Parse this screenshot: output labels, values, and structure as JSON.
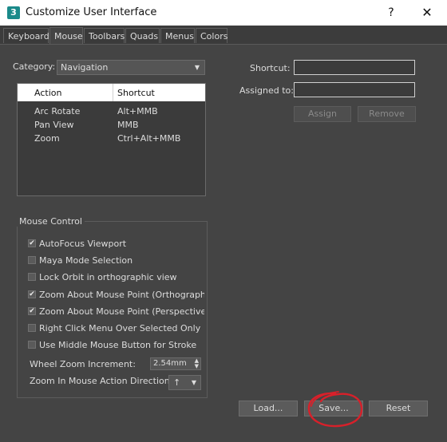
{
  "window": {
    "app_icon": "3",
    "title": "Customize User Interface",
    "help": "?",
    "close": "✕"
  },
  "tabs": [
    {
      "label": "Keyboard"
    },
    {
      "label": "Mouse",
      "active": true
    },
    {
      "label": "Toolbars"
    },
    {
      "label": "Quads"
    },
    {
      "label": "Menus"
    },
    {
      "label": "Colors"
    }
  ],
  "category": {
    "label": "Category:",
    "value": "Navigation"
  },
  "actions_table": {
    "columns": [
      "Action",
      "Shortcut"
    ],
    "rows": [
      {
        "action": "Arc Rotate",
        "shortcut": "Alt+MMB"
      },
      {
        "action": "Pan View",
        "shortcut": "MMB"
      },
      {
        "action": "Zoom",
        "shortcut": "Ctrl+Alt+MMB"
      }
    ]
  },
  "shortcut_panel": {
    "shortcut_label": "Shortcut:",
    "shortcut_value": "",
    "assigned_label": "Assigned to:",
    "assigned_value": "",
    "assign_button": "Assign",
    "remove_button": "Remove"
  },
  "mouse_control": {
    "title": "Mouse Control",
    "options": [
      {
        "label": "AutoFocus Viewport",
        "checked": true
      },
      {
        "label": "Maya Mode Selection",
        "checked": false
      },
      {
        "label": "Lock Orbit in orthographic view",
        "checked": false
      },
      {
        "label": "Zoom About Mouse Point (Orthographic)",
        "checked": true
      },
      {
        "label": "Zoom About Mouse Point (Perspective)",
        "checked": true
      },
      {
        "label": "Right Click Menu Over Selected Only",
        "checked": false
      },
      {
        "label": "Use Middle Mouse Button for Stroke",
        "checked": false
      }
    ],
    "wheel_zoom_label": "Wheel Zoom Increment:",
    "wheel_zoom_value": "2.54mm",
    "zoom_direction_label": "Zoom In Mouse Action Direction:",
    "zoom_direction_value": "↑"
  },
  "footer": {
    "load_button": "Load...",
    "save_button": "Save...",
    "reset_button": "Reset"
  },
  "colors": {
    "annotation": "#d8202a",
    "background": "#444444"
  }
}
